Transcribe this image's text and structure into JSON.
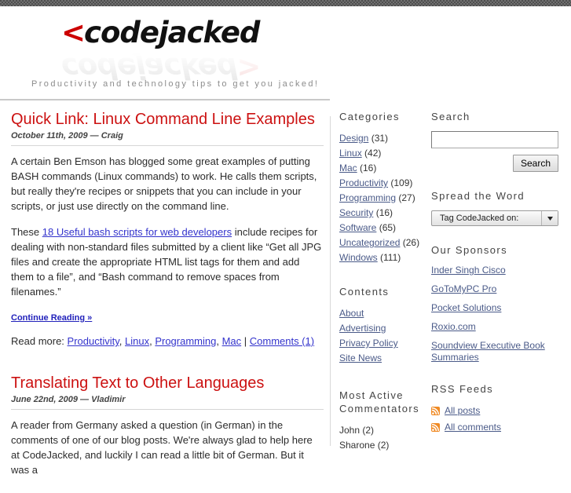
{
  "header": {
    "logo_prefix": "<",
    "logo_text": "codejacked",
    "logo_reflect_suffix": ">",
    "tagline": "Productivity and technology tips to get you jacked!"
  },
  "posts": [
    {
      "title": "Quick Link: Linux Command Line Examples",
      "meta": "October 11th, 2009 — Craig",
      "para1_before": "A certain Ben Emson has blogged some great examples of putting BASH commands (Linux commands) to work.  He calls them scripts, but really they're recipes or snippets that you can include in your scripts, or just use directly on the command line.",
      "para2_before": "These ",
      "para2_link": "18 Useful bash scripts for web developers",
      "para2_after": " include recipes for dealing with non-standard files submitted by a client like “Get all JPG files and create the appropriate HTML list tags for them and add them to a file”, and “Bash command to remove spaces from filenames.”",
      "continue_label": "Continue Reading »",
      "readmore_label": "Read more:",
      "tags": [
        "Productivity",
        "Linux",
        "Programming",
        "Mac"
      ],
      "comments_label": "Comments (1)"
    },
    {
      "title": "Translating Text to Other Languages",
      "meta": "June 22nd, 2009 — Vladimir",
      "para1_before": "A reader from Germany asked a question (in German) in the comments of one of our blog posts.  We're always glad to help here at CodeJacked, and luckily I can read a little bit of German.  But it was a"
    }
  ],
  "categories": {
    "title": "Categories",
    "items": [
      {
        "label": "Design",
        "count": "(31)"
      },
      {
        "label": "Linux",
        "count": "(42)"
      },
      {
        "label": "Mac",
        "count": "(16)"
      },
      {
        "label": "Productivity",
        "count": "(109)"
      },
      {
        "label": "Programming",
        "count": "(27)"
      },
      {
        "label": "Security",
        "count": "(16)"
      },
      {
        "label": "Software",
        "count": "(65)"
      },
      {
        "label": "Uncategorized",
        "count": "(26)"
      },
      {
        "label": "Windows",
        "count": "(111)"
      }
    ]
  },
  "contents": {
    "title": "Contents",
    "items": [
      "About",
      "Advertising",
      "Privacy Policy",
      "Site News"
    ]
  },
  "commentators": {
    "title": "Most Active Commentators",
    "items": [
      {
        "label": "John",
        "count": "(2)"
      },
      {
        "label": "Sharone",
        "count": "(2)"
      }
    ]
  },
  "search": {
    "title": "Search",
    "value": "",
    "placeholder": "",
    "button_label": "Search"
  },
  "spread": {
    "title": "Spread the Word",
    "selected": "Tag CodeJacked on:"
  },
  "sponsors": {
    "title": "Our Sponsors",
    "items": [
      "Inder Singh Cisco",
      "GoToMyPC Pro",
      "Pocket Solutions",
      "Roxio.com",
      "Soundview Executive Book Summaries"
    ]
  },
  "rss": {
    "title": "RSS Feeds",
    "items": [
      "All posts",
      "All comments"
    ]
  },
  "colors": {
    "title_red": "#cc1111",
    "link_blue": "#3333cc",
    "sidebar_link": "#4a5a88",
    "rss_orange": "#f08a24",
    "logo_red": "#cc0000"
  }
}
